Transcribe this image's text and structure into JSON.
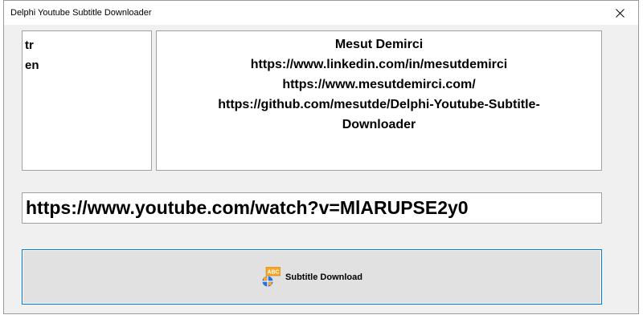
{
  "window": {
    "title": "Delphi Youtube Subtitle Downloader"
  },
  "languages": [
    "tr",
    "en"
  ],
  "info": {
    "lines": [
      "Mesut Demirci",
      "https://www.linkedin.com/in/mesutdemirci",
      "https://www.mesutdemirci.com/",
      "https://github.com/mesutde/Delphi-Youtube-Subtitle-",
      "Downloader"
    ]
  },
  "url_input": {
    "value": "https://www.youtube.com/watch?v=MlARUPSE2y0"
  },
  "download_button": {
    "label": "Subtitle Download",
    "icon": "abc-globe-icon",
    "icon_text": "ABC"
  },
  "colors": {
    "focus_border": "#0078d7",
    "icon_orange": "#f5a623",
    "icon_blue": "#2e6fd1"
  }
}
